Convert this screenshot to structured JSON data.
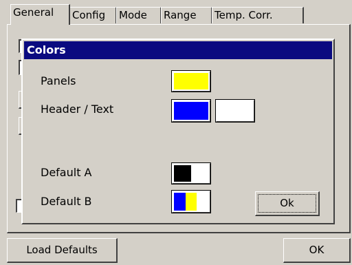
{
  "tabs": [
    "General",
    "Config",
    "Mode",
    "Range",
    "Temp. Corr."
  ],
  "dialog": {
    "title": "Colors",
    "rows": [
      {
        "label": "Panels"
      },
      {
        "label": "Header / Text"
      },
      {
        "label": "Default A"
      },
      {
        "label": "Default B"
      }
    ],
    "ok_label": "Ok"
  },
  "colors": {
    "panels": "#ffff00",
    "header": "#0000ff",
    "text": "#ffffff",
    "default_a": [
      "#000000",
      "#ffffff"
    ],
    "default_b": [
      "#0000ff",
      "#ffff00",
      "#ffffff"
    ]
  },
  "bottom": {
    "load_defaults_label": "Load Defaults",
    "ok_label": "OK"
  }
}
